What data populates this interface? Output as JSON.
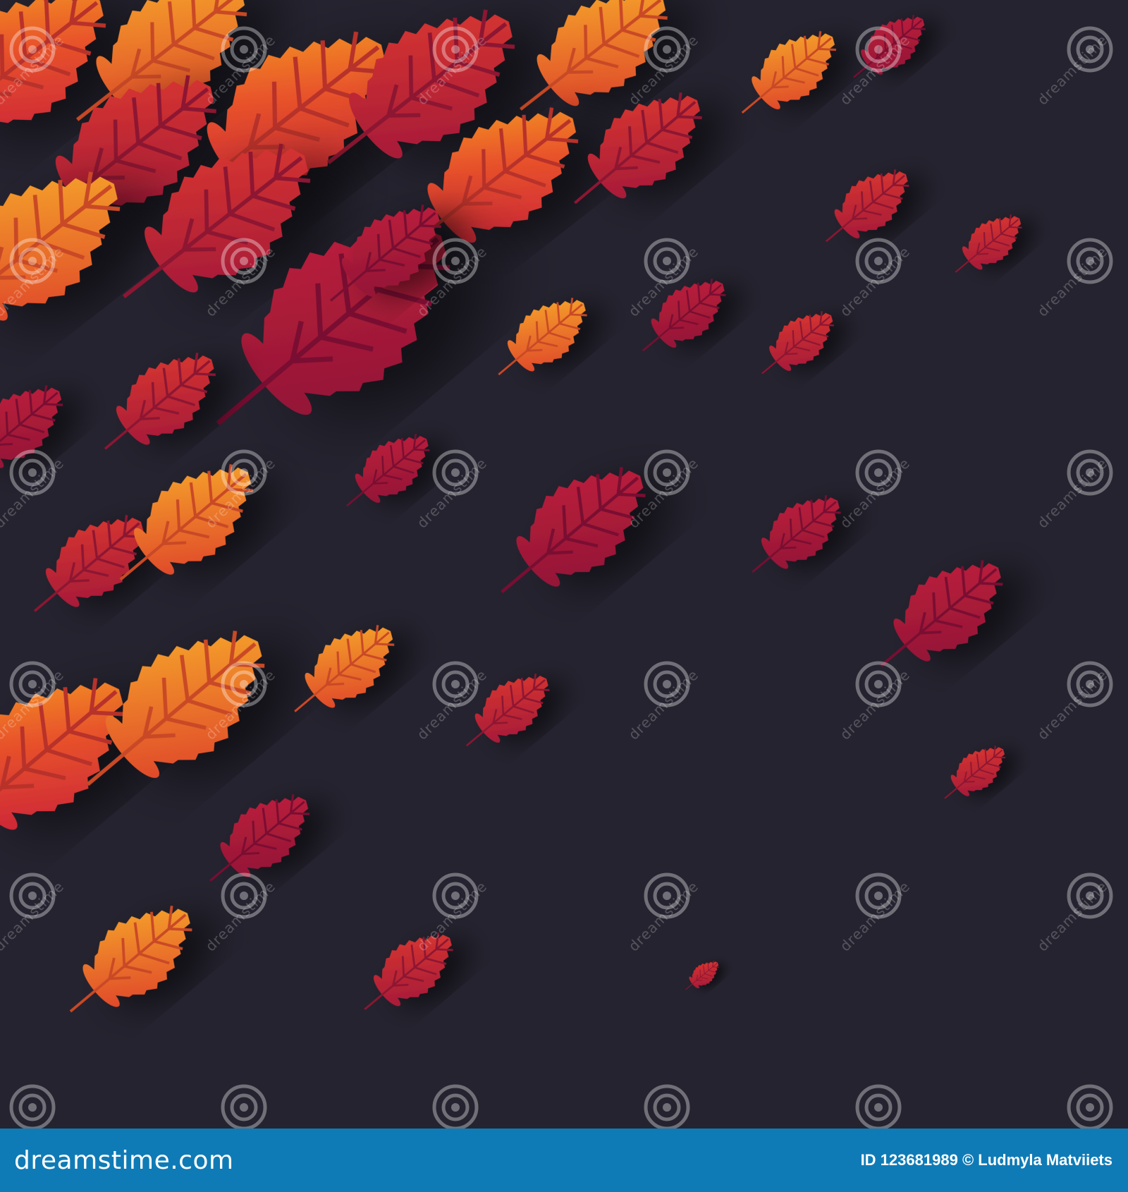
{
  "footer": {
    "logo_text": "dreamstime.com",
    "id_label": "ID",
    "id_number": "123681989",
    "copyright_symbol": "©",
    "author": "Ludmyla Matviiets"
  },
  "watermark": {
    "text": "dreamstime",
    "icon": "spiral-logo-icon"
  },
  "colors": {
    "background": "#25232f",
    "footer": "#0f7bb6",
    "leaf_crimson": "#a3163a",
    "leaf_red": "#d42a2a",
    "leaf_orange": "#f07a1e",
    "leaf_yellow_orange": "#f6a325"
  }
}
